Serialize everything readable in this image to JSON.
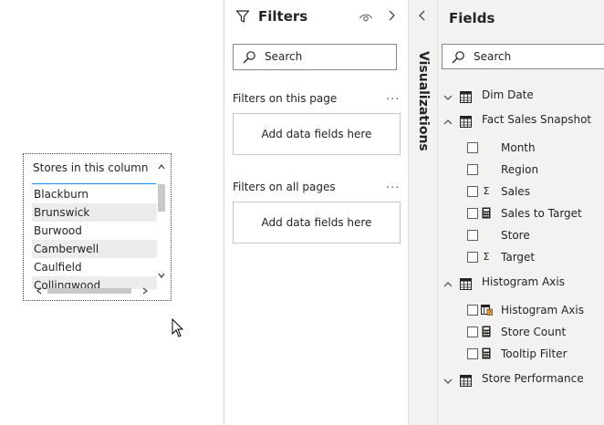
{
  "slicer": {
    "header": "Stores in this column",
    "items": [
      "Blackburn",
      "Brunswick",
      "Burwood",
      "Camberwell",
      "Caulfield",
      "Collingwood"
    ]
  },
  "filters": {
    "title": "Filters",
    "search_placeholder": "Search",
    "page_section": "Filters on this page",
    "page_well": "Add data fields here",
    "all_section": "Filters on all pages",
    "all_well": "Add data fields here",
    "more": "..."
  },
  "visualizations": {
    "label": "Visualizations"
  },
  "fields": {
    "title": "Fields",
    "search_placeholder": "Search",
    "tables": [
      {
        "name": "Dim Date",
        "expanded": false,
        "fields": []
      },
      {
        "name": "Fact Sales Snapshot",
        "expanded": true,
        "fields": [
          {
            "name": "Month",
            "icon": "none"
          },
          {
            "name": "Region",
            "icon": "none"
          },
          {
            "name": "Sales",
            "icon": "sigma"
          },
          {
            "name": "Sales to Target",
            "icon": "calculator"
          },
          {
            "name": "Store",
            "icon": "none"
          },
          {
            "name": "Target",
            "icon": "sigma"
          }
        ]
      },
      {
        "name": "Histogram Axis",
        "expanded": true,
        "fields": [
          {
            "name": "Histogram Axis",
            "icon": "parameter"
          },
          {
            "name": "Store Count",
            "icon": "calculator"
          },
          {
            "name": "Tooltip Filter",
            "icon": "calculator"
          }
        ]
      },
      {
        "name": "Store Performance",
        "expanded": false,
        "fields": []
      }
    ]
  },
  "colors": {
    "accent": "#118dff",
    "pane_bg": "#f3f2f1"
  }
}
